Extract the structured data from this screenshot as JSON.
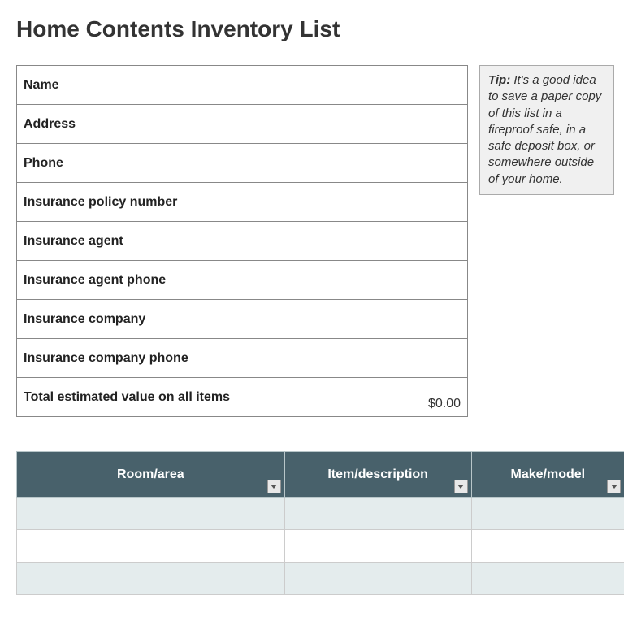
{
  "title": "Home Contents Inventory List",
  "info_fields": {
    "name": {
      "label": "Name",
      "value": ""
    },
    "address": {
      "label": "Address",
      "value": ""
    },
    "phone": {
      "label": "Phone",
      "value": ""
    },
    "policy_number": {
      "label": "Insurance policy number",
      "value": ""
    },
    "agent": {
      "label": "Insurance agent",
      "value": ""
    },
    "agent_phone": {
      "label": "Insurance agent phone",
      "value": ""
    },
    "company": {
      "label": "Insurance company",
      "value": ""
    },
    "company_phone": {
      "label": "Insurance company phone",
      "value": ""
    },
    "total": {
      "label": "Total estimated value on all items",
      "value": "$0.00"
    }
  },
  "tip": {
    "label": "Tip:",
    "text": " It's a good idea to save a paper copy of this list in a fireproof safe, in a safe deposit box, or somewhere outside of your home."
  },
  "columns": {
    "room": "Room/area",
    "item": "Item/description",
    "make": "Make/model"
  }
}
